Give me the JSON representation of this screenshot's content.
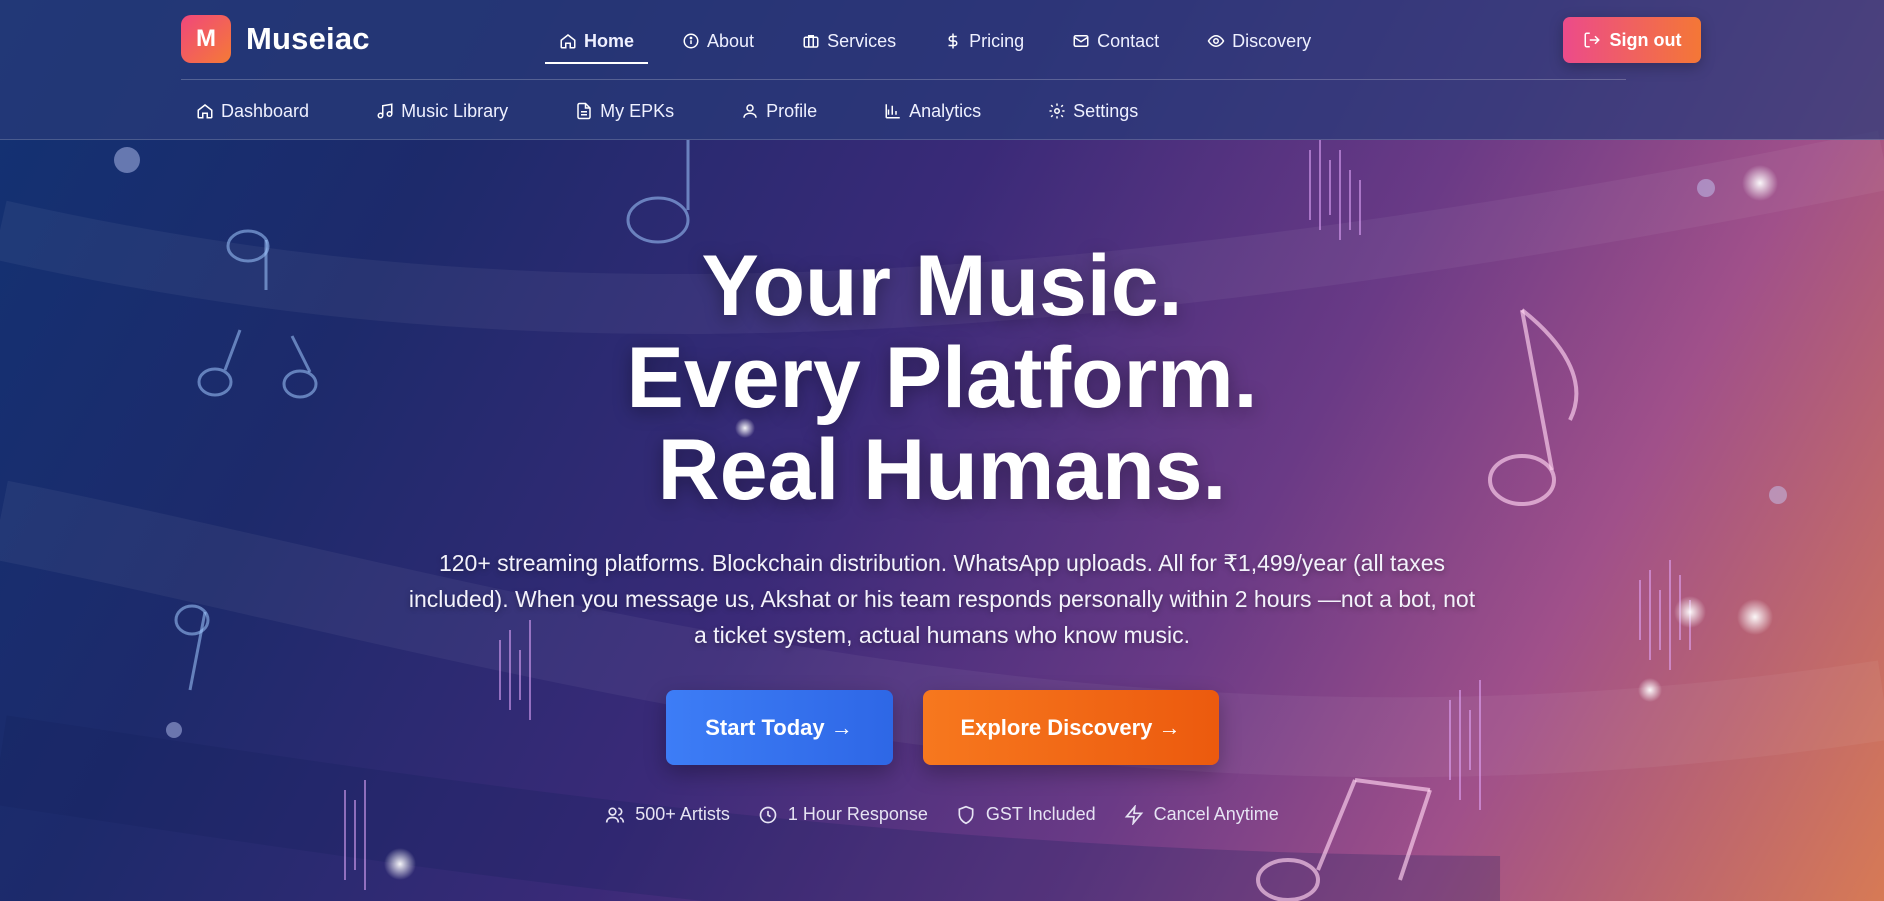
{
  "brand": {
    "logo_letter": "M",
    "name": "Museiac"
  },
  "top_nav": [
    {
      "label": "Home",
      "icon": "home-icon",
      "active": true
    },
    {
      "label": "About",
      "icon": "info-icon",
      "active": false
    },
    {
      "label": "Services",
      "icon": "briefcase-icon",
      "active": false
    },
    {
      "label": "Pricing",
      "icon": "dollar-icon",
      "active": false
    },
    {
      "label": "Contact",
      "icon": "mail-icon",
      "active": false
    },
    {
      "label": "Discovery",
      "icon": "eye-icon",
      "active": false
    }
  ],
  "sign_out": {
    "label": "Sign out",
    "icon": "logout-icon"
  },
  "sub_nav": [
    {
      "label": "Dashboard",
      "icon": "home-icon"
    },
    {
      "label": "Music Library",
      "icon": "music-note-icon"
    },
    {
      "label": "My EPKs",
      "icon": "document-icon"
    },
    {
      "label": "Profile",
      "icon": "user-icon"
    },
    {
      "label": "Analytics",
      "icon": "bar-chart-icon"
    },
    {
      "label": "Settings",
      "icon": "gear-icon"
    }
  ],
  "hero": {
    "title_lines": [
      "Your Music.",
      "Every Platform.",
      "Real Humans."
    ],
    "description": "120+ streaming platforms. Blockchain distribution. WhatsApp uploads. All for ₹1,499/year (all taxes included). When you message us, Akshat or his team responds personally within 2 hours —not a bot, not a ticket system, actual humans who know music.",
    "primary_button": "Start Today →",
    "secondary_button": "Explore Discovery →",
    "badges": [
      {
        "label": "500+ Artists",
        "icon": "users-icon"
      },
      {
        "label": "1 Hour Response",
        "icon": "clock-icon"
      },
      {
        "label": "GST Included",
        "icon": "shield-icon"
      },
      {
        "label": "Cancel Anytime",
        "icon": "lightning-icon"
      }
    ]
  },
  "colors": {
    "brand_gradient": [
      "#f0477c",
      "#f57a36"
    ],
    "primary_button": "#3d7df6",
    "secondary_button": "#f7781e",
    "signout_gradient": [
      "#ec4b8a",
      "#f47736"
    ]
  }
}
